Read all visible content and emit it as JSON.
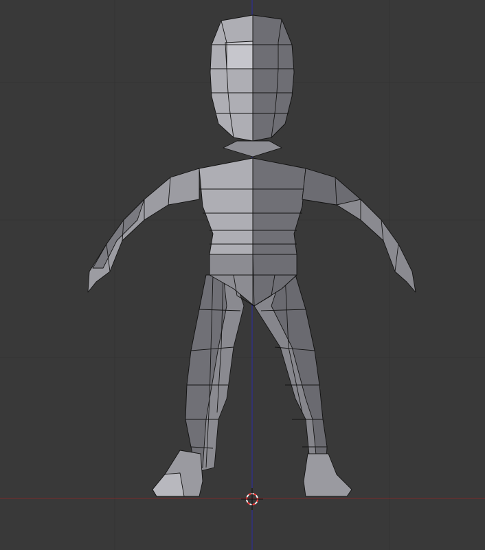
{
  "viewport": {
    "background": "#393939",
    "grid_color": "#333333",
    "x_axis_color": "#7a2a2a",
    "z_axis_color": "#2a2aa8",
    "cursor_colors": {
      "ring_a": "#ff3a3a",
      "ring_b": "#f2f2f2"
    }
  },
  "mesh": {
    "name": "character-low-poly",
    "face_color_light": "#b0b0b6",
    "face_color_dark": "#6c6c72",
    "edge_color": "#111111",
    "vertex_color": "#000000"
  }
}
